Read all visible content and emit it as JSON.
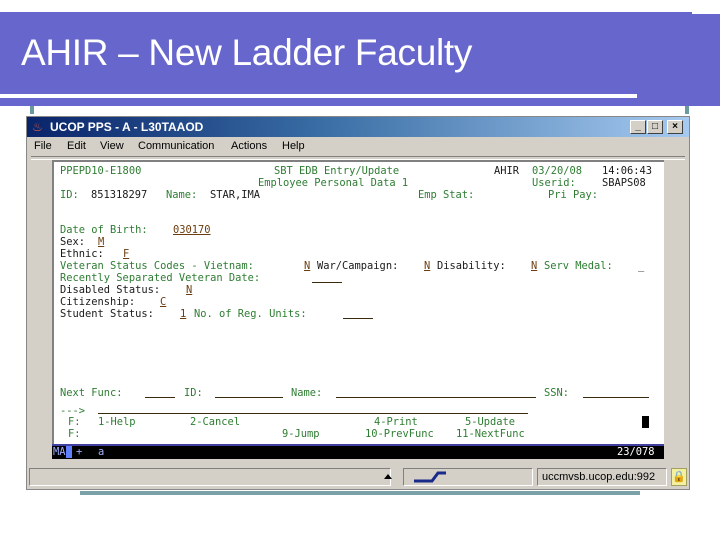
{
  "slide": {
    "title": "AHIR – New Ladder Faculty"
  },
  "window": {
    "title": "UCOP PPS - A - L30TAAOD",
    "controls": [
      "_",
      "□",
      "×"
    ],
    "menu": [
      "File",
      "Edit",
      "View",
      "Communication",
      "Actions",
      "Help"
    ]
  },
  "screen": {
    "header": {
      "screen_id": "PPEPD10-E1800",
      "function_title": "SBT EDB Entry/Update",
      "subtitle": "Employee Personal Data 1",
      "app": "AHIR",
      "date": "03/20/08",
      "time": "14:06:43",
      "userid_label": "Userid:",
      "userid": "SBAPS08",
      "id_label": "ID:",
      "id": "851318297",
      "name_label": "Name:",
      "name": "STAR,IMA",
      "emp_stat_label": "Emp Stat:",
      "pri_pay_label": "Pri Pay:"
    },
    "fields": {
      "dob_label": "Date of Birth:",
      "dob": "030170",
      "sex_label": "Sex:",
      "sex": "M",
      "ethnic_label": "Ethnic:",
      "ethnic": "F",
      "vet_label": "Veteran Status Codes - Vietnam:",
      "vietnam": "N",
      "war_label": "War/Campaign:",
      "war": "N",
      "disability_label": "Disability:",
      "disability": "N",
      "serv_medal_label": "Serv Medal:",
      "serv_medal": "_",
      "recent_vet_label": "Recently Separated Veteran Date:",
      "disabled_label": "Disabled Status:",
      "disabled": "N",
      "citizenship_label": "Citizenship:",
      "citizenship": "C",
      "student_label": "Student Status:",
      "student": "1",
      "reg_units_label": "No. of Reg. Units:"
    },
    "footer": {
      "next_func_label": "Next Func:",
      "id_label": "ID:",
      "name_label": "Name:",
      "ssn_label": "SSN:",
      "prompt": "--->",
      "f_label": "F:",
      "keys_row1": [
        "1-Help",
        "2-Cancel",
        "4-Print",
        "5-Update"
      ],
      "keys_row2": [
        "9-Jump",
        "10-PrevFunc",
        "11-NextFunc"
      ]
    },
    "status": {
      "mode_left": "MA",
      "mode_plus": "+",
      "mode_a": "a",
      "cursor_pos": "23/078"
    }
  },
  "statusbar": {
    "host": "uccmvsb.ucop.edu:992"
  }
}
